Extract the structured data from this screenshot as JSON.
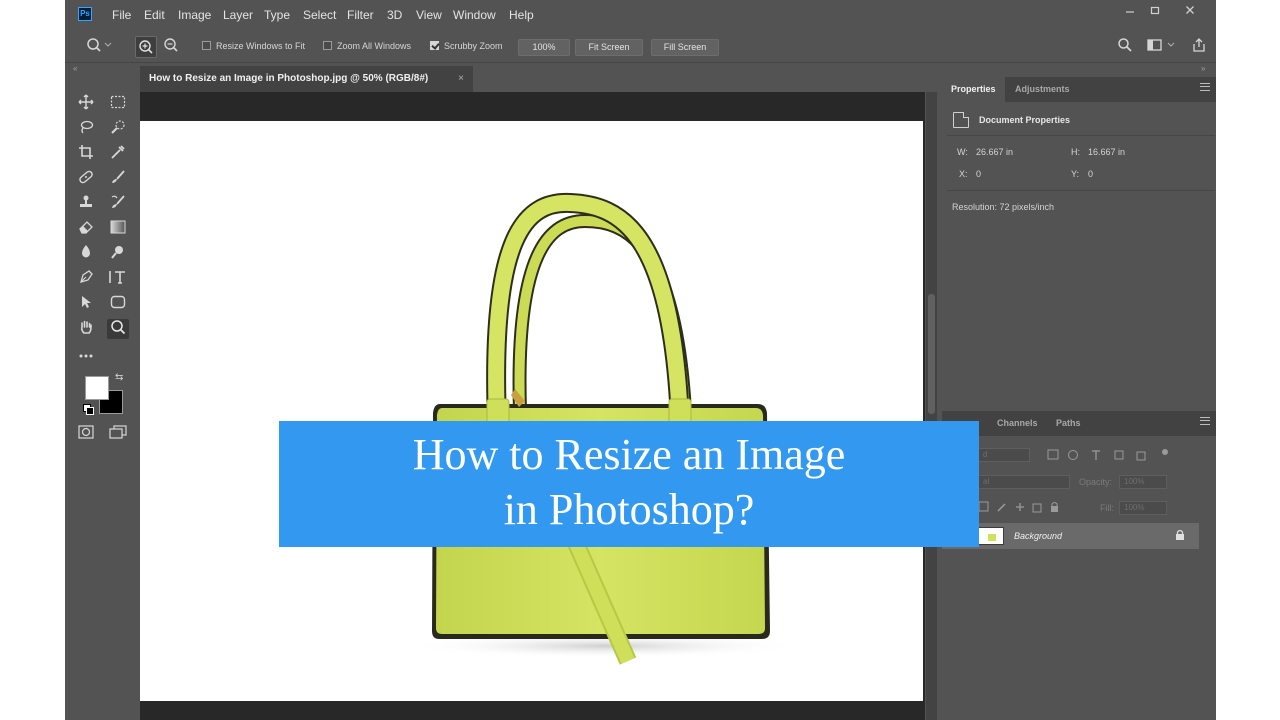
{
  "app": {
    "logo": "Ps"
  },
  "menu": [
    "File",
    "Edit",
    "Image",
    "Layer",
    "Type",
    "Select",
    "Filter",
    "3D",
    "View",
    "Window",
    "Help"
  ],
  "options_bar": {
    "resize_windows": {
      "label": "Resize Windows to Fit",
      "checked": false
    },
    "zoom_all": {
      "label": "Zoom All Windows",
      "checked": false
    },
    "scrubby_zoom": {
      "label": "Scrubby Zoom",
      "checked": true
    },
    "zoom_value": "100%",
    "fit_screen": "Fit Screen",
    "fill_screen": "Fill Screen"
  },
  "document": {
    "tab_title": "How to Resize an Image in Photoshop.jpg @ 50% (RGB/8#)",
    "close_glyph": "×"
  },
  "banner": {
    "line1": "How to Resize an Image",
    "line2": "in Photoshop?"
  },
  "properties_panel": {
    "tabs": [
      "Properties",
      "Adjustments"
    ],
    "header": "Document Properties",
    "w_label": "W:",
    "w_value": "26.667 in",
    "h_label": "H:",
    "h_value": "16.667 in",
    "x_label": "X:",
    "x_value": "0",
    "y_label": "Y:",
    "y_value": "0",
    "resolution": "Resolution: 72 pixels/inch"
  },
  "layers_panel": {
    "tabs": [
      "Channels",
      "Paths"
    ],
    "kind_partial": "d",
    "mode_partial": "al",
    "opacity_label": "Opacity:",
    "opacity_value": "100%",
    "fill_label": "Fill:",
    "fill_value": "100%",
    "layer_name": "Background"
  },
  "colors": {
    "foreground": "#ffffff",
    "background": "#000000",
    "banner": "#3399f0",
    "bag": "#d1e25a"
  },
  "icons": {
    "toolbar": [
      "move",
      "marquee",
      "lasso",
      "quick-select",
      "crop",
      "eyedropper",
      "healing",
      "brush",
      "stamp",
      "history-brush",
      "eraser",
      "gradient",
      "blur",
      "dodge",
      "pen",
      "type",
      "path-select",
      "shape",
      "hand",
      "zoom",
      "more",
      "quick-mask",
      "screen-mode"
    ]
  }
}
